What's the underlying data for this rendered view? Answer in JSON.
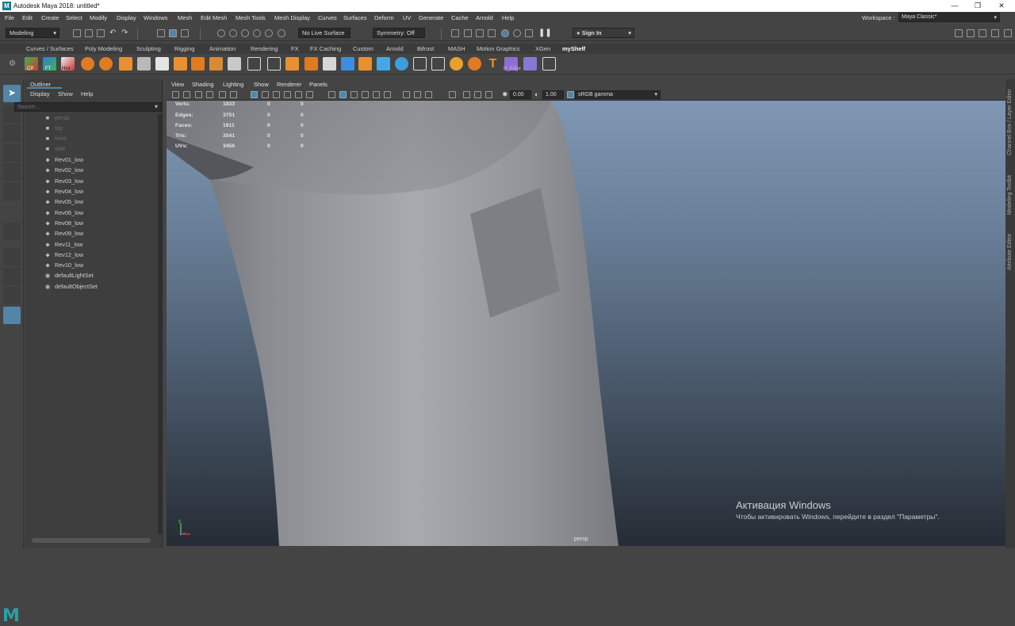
{
  "titlebar": {
    "title": "Autodesk Maya 2018: untitled*",
    "logo": "M",
    "min": "—",
    "restore": "❐",
    "close": "✕"
  },
  "menubar": {
    "items": [
      "File",
      "Edit",
      "Create",
      "Select",
      "Modify",
      "Display",
      "Windows",
      "Mesh",
      "Edit Mesh",
      "Mesh Tools",
      "Mesh Display",
      "Curves",
      "Surfaces",
      "Deform",
      "UV",
      "Generate",
      "Cache",
      "Arnold",
      "Help"
    ],
    "workspace_label": "Workspace :",
    "workspace_value": "Maya Classic*"
  },
  "statusline": {
    "mode": "Modeling",
    "live_surface": "No Live Surface",
    "symmetry": "Symmetry: Off",
    "sign_in": "Sign In"
  },
  "shelf": {
    "tabs": [
      "Curves / Surfaces",
      "Poly Modeling",
      "Sculpting",
      "Rigging",
      "Animation",
      "Rendering",
      "FX",
      "FX Caching",
      "Custom",
      "Arnold",
      "Bifrost",
      "MASH",
      "Motion Graphics",
      "XGen",
      "myShelf"
    ],
    "active_tab": "myShelf",
    "button_labels": [
      "CP",
      "FT",
      "Hist",
      "H_Edge"
    ]
  },
  "outliner": {
    "title": "Outliner",
    "menus": [
      "Display",
      "Show",
      "Help"
    ],
    "search_placeholder": "Search...",
    "cameras": [
      "persp",
      "top",
      "front",
      "side"
    ],
    "meshes": [
      "Rev01_low",
      "Rev02_low",
      "Rev03_low",
      "Rev04_low",
      "Rev05_low",
      "Rev06_low",
      "Rev08_low",
      "Rev09_low",
      "Rev11_low",
      "Rev12_low",
      "Rev10_low"
    ],
    "sets": [
      "defaultLightSet",
      "defaultObjectSet"
    ]
  },
  "viewport": {
    "menus": [
      "View",
      "Shading",
      "Lighting",
      "Show",
      "Renderer",
      "Panels"
    ],
    "exposure": "0.00",
    "gamma": "1.00",
    "color_space": "sRGB gamma",
    "camera": "persp",
    "hud": [
      {
        "label": "Verts:",
        "v1": "1833",
        "v2": "0",
        "v3": "0"
      },
      {
        "label": "Edges:",
        "v1": "3751",
        "v2": "0",
        "v3": "0"
      },
      {
        "label": "Faces:",
        "v1": "1911",
        "v2": "0",
        "v3": "0"
      },
      {
        "label": "Tris:",
        "v1": "3541",
        "v2": "0",
        "v3": "0"
      },
      {
        "label": "UVs:",
        "v1": "3456",
        "v2": "0",
        "v3": "0"
      }
    ]
  },
  "side_tabs": [
    "Channel Box / Layer Editor",
    "Modeling Toolkit",
    "Attribute Editor"
  ],
  "watermark": {
    "line1": "Активация Windows",
    "line2": "Чтобы активировать Windows, перейдите в раздел \"Параметры\"."
  },
  "axis": {
    "x": "x",
    "y": "y"
  },
  "logo": "M"
}
